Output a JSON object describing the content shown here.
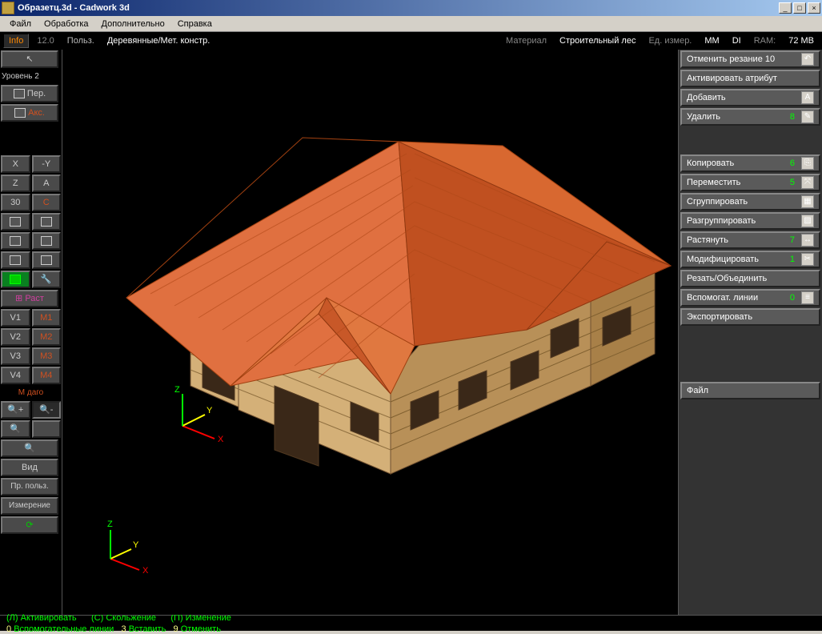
{
  "title": "Образетц.3d - Cadwork 3d",
  "menubar": [
    "Файл",
    "Обработка",
    "Дополнительно",
    "Справка"
  ],
  "infobar": {
    "info": "Info",
    "version": "12.0",
    "user": "Польз.",
    "material_type": "Деревянные/Мет. констр.",
    "material_label": "Материал",
    "material_value": "Строительный лес",
    "unit_label": "Ед. измер.",
    "unit": "ММ",
    "di": "DI",
    "ram_label": "RAM:",
    "ram": "72 MB"
  },
  "left_panel": {
    "level": "Уровень 2",
    "per": "Пер.",
    "acc": "Акс.",
    "axes": {
      "x": "X",
      "neg_y": "-Y",
      "z": "Z",
      "a": "A",
      "thirty": "30",
      "c": "C"
    },
    "p_rast": "Раст",
    "views": [
      "V1",
      "V2",
      "V3",
      "V4"
    ],
    "m_each": [
      "M1",
      "M2",
      "M3",
      "M4"
    ],
    "m_label": "М даго",
    "vid": "Вид",
    "pr_polz": "Пр. польз.",
    "izmerenie": "Измерение"
  },
  "right_panel": [
    {
      "label": "Отменить резание 10",
      "count": null,
      "icon": "undo"
    },
    {
      "label": "Активировать атрибут",
      "count": null,
      "icon": null
    },
    {
      "label": "Добавить",
      "count": null,
      "icon": "text-a"
    },
    {
      "label": "Удалить",
      "count": "8",
      "icon": "brush"
    },
    null,
    {
      "label": "Копировать",
      "count": "6",
      "icon": "copy"
    },
    {
      "label": "Переместить",
      "count": "5",
      "icon": "move"
    },
    {
      "label": "Сгруппировать",
      "count": null,
      "icon": "group"
    },
    {
      "label": "Разгруппировать",
      "count": null,
      "icon": "ungroup"
    },
    {
      "label": "Растянуть",
      "count": "7",
      "icon": "stretch"
    },
    {
      "label": "Модифицировать",
      "count": "1",
      "icon": "modify"
    },
    {
      "label": "Резать/Объединить",
      "count": null,
      "icon": null
    },
    {
      "label": "Вспомогат. линии",
      "count": "0",
      "icon": "lines"
    },
    {
      "label": "Экспортировать",
      "count": null,
      "icon": null
    },
    null,
    null,
    {
      "label": "Файл",
      "count": null,
      "icon": null
    }
  ],
  "statusbar": {
    "l": "(Л) Активировать",
    "c": "(С) Скольжение",
    "p": "(П) Изменение",
    "line2": {
      "zero": "0",
      "helper": "Вспомогательные линии",
      "three": "3",
      "insert": "Вставить",
      "nine": "9",
      "cancel": "Отменить"
    }
  },
  "colors": {
    "roof": "#d86830",
    "roof_dark": "#b04818",
    "wall": "#c8a060",
    "wall_dark": "#907040"
  }
}
